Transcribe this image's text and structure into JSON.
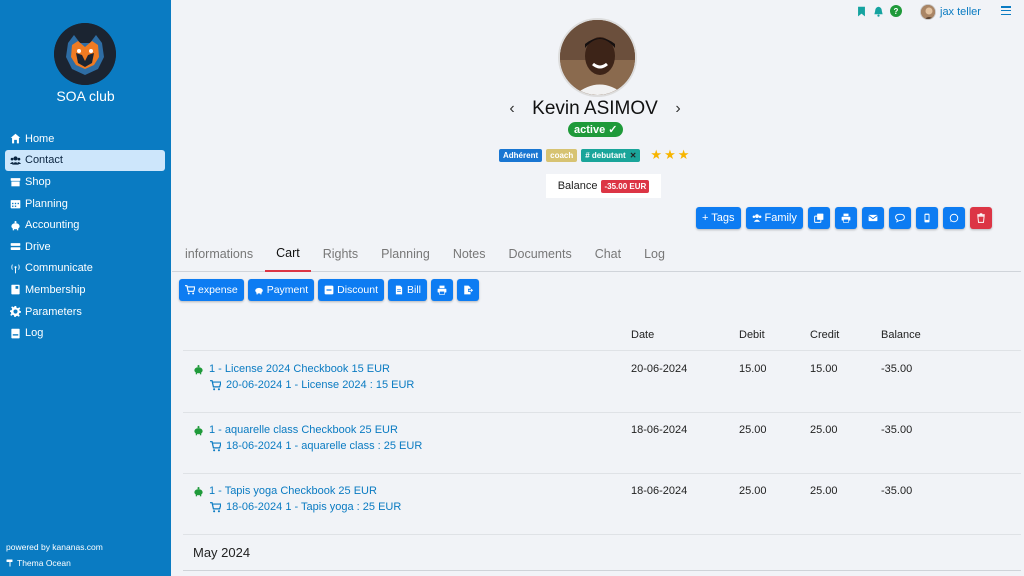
{
  "sidebar": {
    "club_name": "SOA club",
    "items": [
      {
        "label": "Home",
        "icon": "home-icon"
      },
      {
        "label": "Contact",
        "icon": "users-icon",
        "active": true
      },
      {
        "label": "Shop",
        "icon": "shop-icon"
      },
      {
        "label": "Planning",
        "icon": "calendar-icon"
      },
      {
        "label": "Accounting",
        "icon": "piggy-bank-icon"
      },
      {
        "label": "Drive",
        "icon": "drive-icon"
      },
      {
        "label": "Communicate",
        "icon": "broadcast-icon"
      },
      {
        "label": "Membership",
        "icon": "membership-icon"
      },
      {
        "label": "Parameters",
        "icon": "gear-icon"
      },
      {
        "label": "Log",
        "icon": "log-icon"
      }
    ],
    "powered_by": "powered by kananas.com",
    "theme": "Thema Ocean"
  },
  "topbar": {
    "user_name": "jax teller",
    "help_label": "?"
  },
  "profile": {
    "name": "Kevin ASIMOV",
    "status": "active",
    "tags": [
      {
        "label": "Adhérent",
        "color": "#1976d2"
      },
      {
        "label": "coach",
        "color": "#d7c372"
      },
      {
        "label": "# debutant",
        "color": "#1aa59a",
        "removable": true
      }
    ],
    "rating": 3,
    "balance_label": "Balance",
    "balance_value": "-35.00 EUR"
  },
  "actions": {
    "tags": "+ Tags",
    "family": "Family"
  },
  "tabs": [
    "informations",
    "Cart",
    "Rights",
    "Planning",
    "Notes",
    "Documents",
    "Chat",
    "Log"
  ],
  "active_tab": "Cart",
  "cart_actions": [
    "expense",
    "Payment",
    "Discount",
    "Bill"
  ],
  "table": {
    "headers": {
      "date": "Date",
      "debit": "Debit",
      "credit": "Credit",
      "balance": "Balance"
    },
    "rows": [
      {
        "title": "1 - License 2024 Checkbook 15 EUR",
        "sub": "20-06-2024 1 - License 2024 : 15 EUR",
        "date": "20-06-2024",
        "debit": "15.00",
        "credit": "15.00",
        "balance": "-35.00"
      },
      {
        "title": "1 - aquarelle class Checkbook 25 EUR",
        "sub": "18-06-2024 1 - aquarelle class : 25 EUR",
        "date": "18-06-2024",
        "debit": "25.00",
        "credit": "25.00",
        "balance": "-35.00"
      },
      {
        "title": "1 - Tapis yoga Checkbook 25 EUR",
        "sub": "18-06-2024 1 - Tapis yoga : 25 EUR",
        "date": "18-06-2024",
        "debit": "25.00",
        "credit": "25.00",
        "balance": "-35.00"
      }
    ],
    "month_label": "May 2024"
  },
  "colors": {
    "sidebar": "#0a7bc2",
    "primary": "#0d7cf2",
    "danger": "#dc3545",
    "success": "#1f9a3a"
  }
}
